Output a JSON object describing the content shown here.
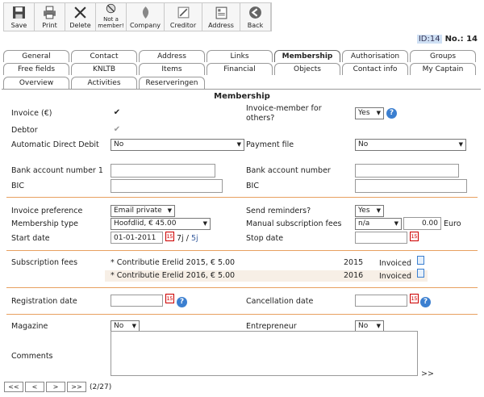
{
  "toolbar": [
    {
      "label": "Save",
      "icon": "save-icon"
    },
    {
      "label": "Print",
      "icon": "print-icon"
    },
    {
      "label": "Delete",
      "icon": "delete-icon"
    },
    {
      "label": "Not a member!",
      "icon": "not-member-icon"
    },
    {
      "label": "Company",
      "icon": "company-icon"
    },
    {
      "label": "Creditor",
      "icon": "creditor-icon"
    },
    {
      "label": "Address",
      "icon": "address-icon"
    },
    {
      "label": "Back",
      "icon": "back-icon"
    }
  ],
  "record": {
    "id_label": "ID:14",
    "no_label": "No.: 14"
  },
  "tabs": {
    "row1": [
      "General",
      "Contact",
      "Address",
      "Links",
      "Membership",
      "Authorisation",
      "Groups"
    ],
    "row2": [
      "Free fields",
      "KNLTB",
      "Items",
      "Financial",
      "Objects",
      "Contact info",
      "My Captain"
    ],
    "row3": [
      "Overview",
      "Activities",
      "Reserveringen"
    ],
    "active": "Membership"
  },
  "section_title": "Membership",
  "fields": {
    "invoice_label": "Invoice (€)",
    "invoice_member_label": "Invoice-member for others?",
    "invoice_member_value": "Yes",
    "debtor_label": "Debtor",
    "auto_debit_label": "Automatic Direct Debit",
    "auto_debit_value": "No",
    "payment_file_label": "Payment file",
    "payment_file_value": "No",
    "bank1_label": "Bank account number 1",
    "bank_label": "Bank account number",
    "bic_label": "BIC",
    "bic2_label": "BIC",
    "invoice_pref_label": "Invoice preference",
    "invoice_pref_value": "Email private",
    "send_reminders_label": "Send reminders?",
    "send_reminders_value": "Yes",
    "membership_type_label": "Membership type",
    "membership_type_value": "Hoofdlid, € 45.00",
    "manual_fees_label": "Manual subscription fees",
    "manual_fees_value": "n/a",
    "manual_fees_amount": "0.00",
    "manual_fees_unit": "Euro",
    "start_date_label": "Start date",
    "start_date_value": "01-01-2011",
    "start_date_extra": "7j / ",
    "start_date_link": "5j",
    "stop_date_label": "Stop date",
    "subscription_fees_label": "Subscription fees",
    "registration_date_label": "Registration date",
    "cancellation_date_label": "Cancellation date",
    "magazine_label": "Magazine",
    "magazine_value": "No",
    "entrepreneur_label": "Entrepreneur",
    "entrepreneur_value": "No",
    "comments_label": "Comments",
    "comments_more": ">>"
  },
  "subscriptions": [
    {
      "desc": "* Contributie Erelid 2015, € 5.00",
      "year": "2015",
      "status": "Invoiced"
    },
    {
      "desc": "* Contributie Erelid 2016, € 5.00",
      "year": "2016",
      "status": "Invoiced"
    }
  ],
  "pager": {
    "first": "<<",
    "prev": "<",
    "next": ">",
    "last": ">>",
    "position": "(2/27)"
  },
  "colors": {
    "separator": "#e8a060",
    "help": "#3b7fd0"
  }
}
